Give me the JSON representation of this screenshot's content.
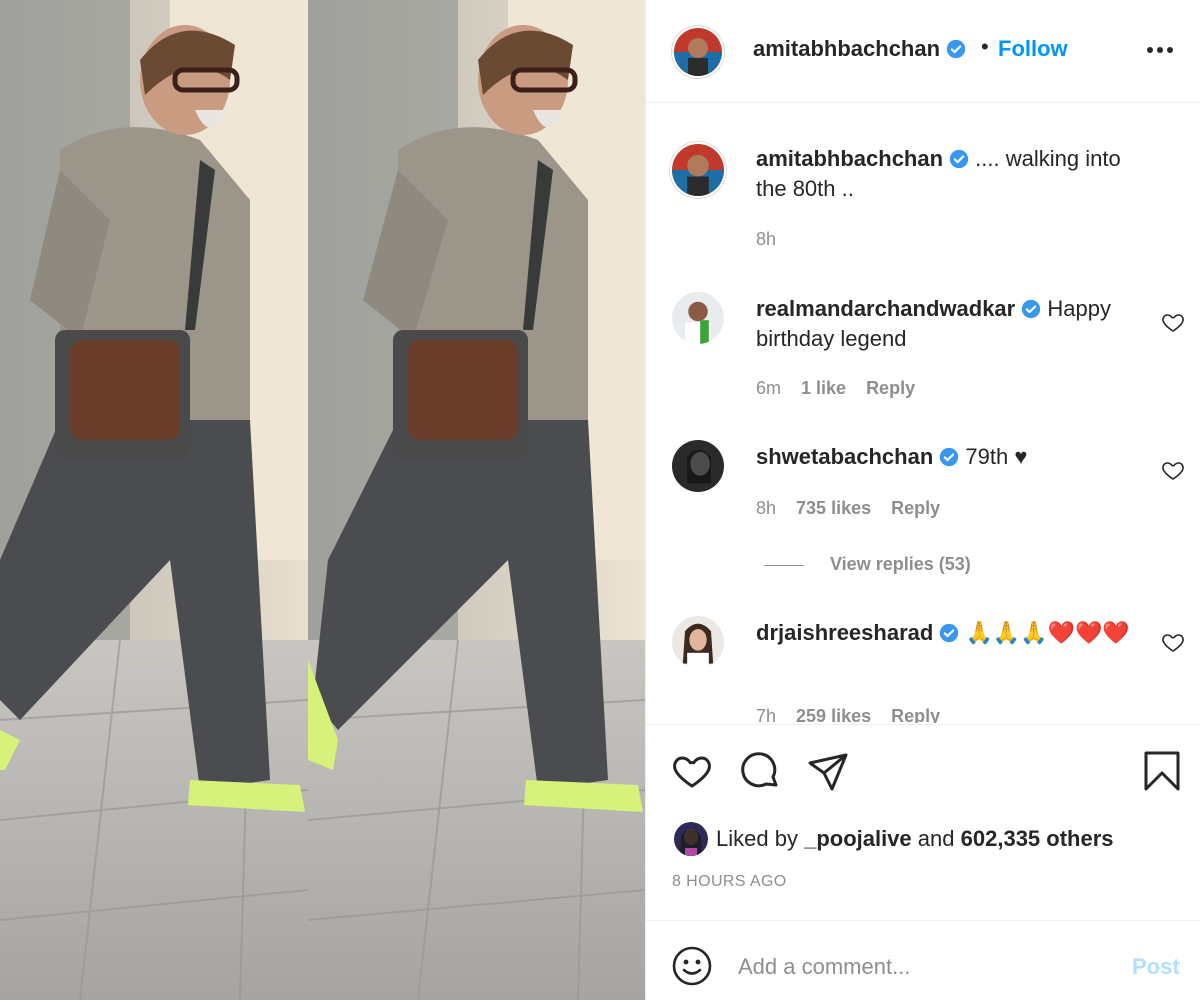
{
  "post": {
    "username": "amitabhbachchan",
    "dot": "•",
    "follow_label": "Follow",
    "more_icon": "more-horizontal-icon",
    "caption_user": "amitabhbachchan",
    "caption_text": ".... walking into the 80th ..",
    "caption_time": "8h"
  },
  "comments": [
    {
      "user": "realmandarchandwadkar",
      "text": "Happy birthday legend",
      "time": "6m",
      "likes": "1 like",
      "reply": "Reply"
    },
    {
      "user": "shwetabachchan",
      "text": "79th ♥",
      "time": "8h",
      "likes": "735 likes",
      "reply": "Reply",
      "view_replies": "View replies (53)"
    },
    {
      "user": "drjaishreesharad",
      "text": "🙏🙏🙏❤️❤️❤️",
      "time": "7h",
      "likes": "259 likes",
      "reply": "Reply"
    }
  ],
  "actions": {
    "like_icon": "heart-icon",
    "comment_icon": "comment-icon",
    "share_icon": "share-icon",
    "save_icon": "bookmark-icon",
    "liked_by_prefix": "Liked by",
    "liked_by_user": "_poojalive",
    "liked_by_and": "and",
    "liked_by_count": "602,335 others",
    "time_ago": "8 HOURS AGO"
  },
  "add_comment": {
    "placeholder": "Add a comment...",
    "post_label": "Post",
    "emoji_icon": "smiley-icon"
  },
  "colors": {
    "link_blue": "#0095f6",
    "post_disabled": "#b2dffc",
    "verified_blue": "#3897f0",
    "muted": "#8e8e8e",
    "text": "#262626"
  }
}
